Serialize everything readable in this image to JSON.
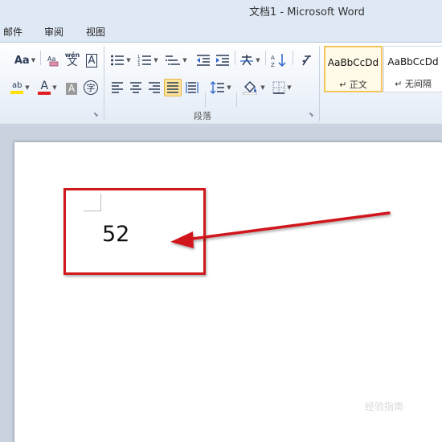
{
  "window": {
    "title": "文档1  -  Microsoft Word"
  },
  "tabs": [
    {
      "label": "邮件"
    },
    {
      "label": "审阅"
    },
    {
      "label": "视图"
    }
  ],
  "ribbon": {
    "font_group": {
      "change_case_label": "Aa",
      "phonetic_label": "wén",
      "phonetic_char": "文",
      "char_border_label": "A",
      "highlight_label": "ab",
      "font_color_label": "A",
      "char_shading_label": "A",
      "enclose_label": "字",
      "highlight_color": "#ffe000",
      "font_color": "#e02020"
    },
    "paragraph_group": {
      "label": "段落",
      "selected_alignment": "justify"
    },
    "styles": [
      {
        "sample": "AaBbCcDd",
        "name": "↵ 正文",
        "selected": true
      },
      {
        "sample": "AaBbCcDd",
        "name": "↵ 无间隔",
        "selected": false
      }
    ]
  },
  "document": {
    "text": "52"
  },
  "annotation": {
    "box_color": "#d0191b"
  },
  "watermark": "经验指南"
}
